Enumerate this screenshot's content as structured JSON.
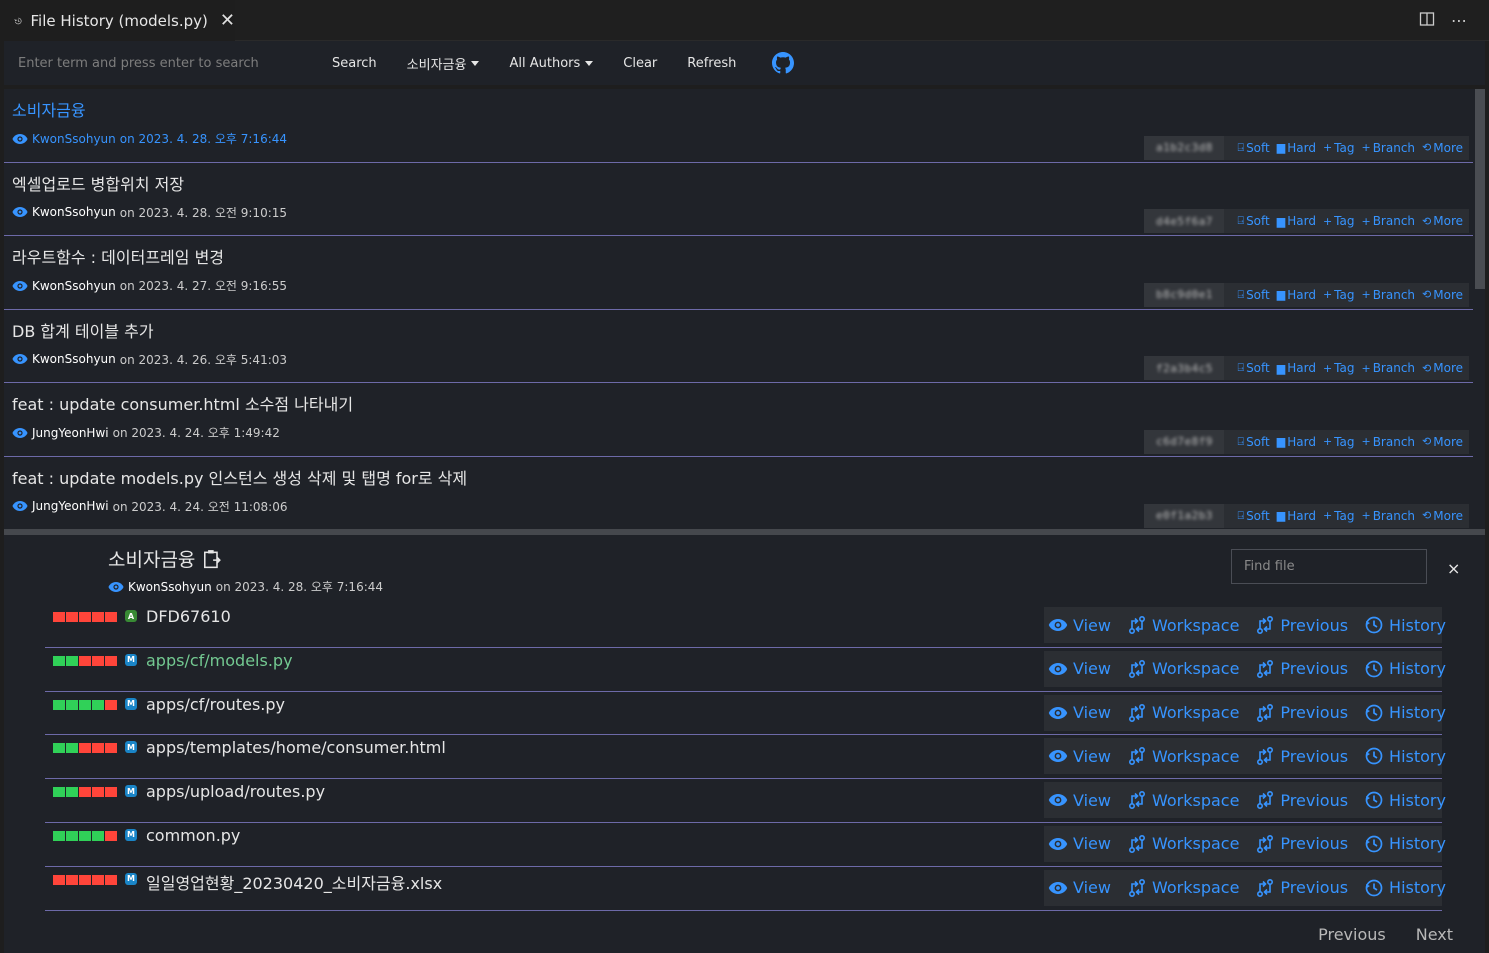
{
  "tab": {
    "title": "File History (models.py)"
  },
  "toolbar": {
    "search_placeholder": "Enter term and press enter to search",
    "search_label": "Search",
    "branch_label": "소비자금융",
    "authors_label": "All Authors",
    "clear_label": "Clear",
    "refresh_label": "Refresh"
  },
  "commit_actions": {
    "soft": "Soft",
    "hard": "Hard",
    "tag": "Tag",
    "branch": "Branch",
    "more": "More"
  },
  "commits": [
    {
      "message": "소비자금융",
      "author": "KwonSsohyun",
      "date": "on 2023. 4. 28. 오후 7:16:44",
      "hash": "a1b2c3d8"
    },
    {
      "message": "엑셀업로드 병합위치 저장",
      "author": "KwonSsohyun",
      "date": "on 2023. 4. 28. 오전 9:10:15",
      "hash": "d4e5f6a7"
    },
    {
      "message": "라우트함수 : 데이터프레임 변경",
      "author": "KwonSsohyun",
      "date": "on 2023. 4. 27. 오전 9:16:55",
      "hash": "b8c9d0e1"
    },
    {
      "message": "DB 합계 테이블 추가",
      "author": "KwonSsohyun",
      "date": "on 2023. 4. 26. 오후 5:41:03",
      "hash": "f2a3b4c5"
    },
    {
      "message": "feat : update consumer.html 소수점 나타내기",
      "author": "JungYeonHwi",
      "date": "on 2023. 4. 24. 오후 1:49:42",
      "hash": "c6d7e8f9"
    },
    {
      "message": "feat : update models.py 인스턴스 생성 삭제 및 탭명 for로 삭제",
      "author": "JungYeonHwi",
      "date": "on 2023. 4. 24. 오전 11:08:06",
      "hash": "e0f1a2b3"
    }
  ],
  "detail": {
    "title": "소비자금융",
    "author": "KwonSsohyun",
    "date": "on 2023. 4. 28. 오후 7:16:44",
    "find_placeholder": "Find file",
    "close": "×"
  },
  "file_actions": {
    "view": "View",
    "workspace": "Workspace",
    "previous": "Previous",
    "history": "History"
  },
  "files": [
    {
      "name": "DFD67610",
      "status": "A",
      "bars": [
        "r",
        "r",
        "r",
        "r",
        "r"
      ]
    },
    {
      "name": "apps/cf/models.py",
      "status": "M",
      "bars": [
        "g",
        "g",
        "r",
        "r",
        "r"
      ]
    },
    {
      "name": "apps/cf/routes.py",
      "status": "M",
      "bars": [
        "g",
        "g",
        "g",
        "g",
        "r"
      ]
    },
    {
      "name": "apps/templates/home/consumer.html",
      "status": "M",
      "bars": [
        "g",
        "g",
        "r",
        "r",
        "r"
      ]
    },
    {
      "name": "apps/upload/routes.py",
      "status": "M",
      "bars": [
        "g",
        "g",
        "r",
        "r",
        "r"
      ]
    },
    {
      "name": "common.py",
      "status": "M",
      "bars": [
        "g",
        "g",
        "g",
        "g",
        "r"
      ]
    },
    {
      "name": "일일영업현황_20230420_소비자금융.xlsx",
      "status": "M",
      "bars": [
        "r",
        "r",
        "r",
        "r",
        "r"
      ]
    }
  ],
  "pager": {
    "previous": "Previous",
    "next": "Next"
  },
  "colors": {
    "accent": "#3794ff",
    "added": "#30d158",
    "deleted": "#ff453a",
    "divider": "#6d6aa8"
  }
}
